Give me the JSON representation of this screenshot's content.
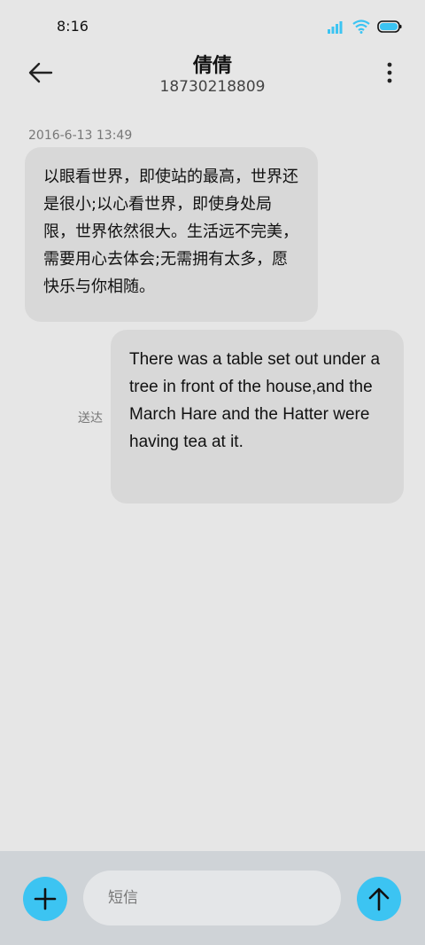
{
  "status_bar": {
    "time": "8:16"
  },
  "header": {
    "contact_name": "倩倩",
    "contact_number": "18730218809"
  },
  "conversation": {
    "timestamp": "2016-6-13 13:49",
    "messages": [
      {
        "direction": "incoming",
        "text": "以眼看世界，即使站的最高，世界还是很小;以心看世界，即使身处局限，世界依然很大。生活远不完美，需要用心去体会;无需拥有太多，愿快乐与你相随。"
      },
      {
        "direction": "outgoing",
        "text": "There was a table set out under a tree in front of the house,and the March Hare and the Hatter were having tea at it.",
        "status": "送达"
      }
    ]
  },
  "composer": {
    "placeholder": "短信",
    "value": ""
  },
  "icons": {
    "back": "arrow-left-icon",
    "more": "more-vertical-icon",
    "add": "plus-icon",
    "send": "arrow-up-icon",
    "signal": "signal-icon",
    "wifi": "wifi-icon",
    "battery": "battery-icon"
  },
  "colors": {
    "accent": "#3cc4f2",
    "background": "#e6e6e6",
    "bubble": "#d8d8d8"
  }
}
